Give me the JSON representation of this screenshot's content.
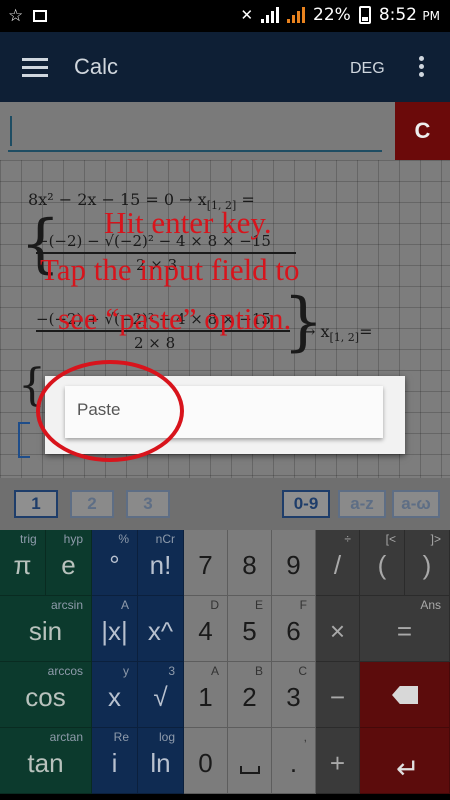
{
  "status_bar": {
    "battery": "22%",
    "time": "8:52",
    "ampm": "PM"
  },
  "app_bar": {
    "title": "Calc",
    "angle_mode": "DEG"
  },
  "input": {
    "value": "",
    "clear_label": "C"
  },
  "work": {
    "line1": "8x² − 2x − 15 = 0 → x",
    "line1_sub": "[1, 2]",
    "line1_tail": " =",
    "num1": "−(−2) − √(−2)² − 4 × 8 × −15",
    "den1": "2 × 3",
    "num2": "−(−2) + √(−2)² − 4 × 8 × −15",
    "den2": "2 × 8",
    "line2_tail": "→ x",
    "line2_sub": "[1, 2]",
    "line2_eq": "="
  },
  "overlay_instruction": [
    "Hit enter key.",
    "Tap the input field to",
    "see “paste” option."
  ],
  "popup": {
    "paste_label": "Paste"
  },
  "tabs": [
    "1",
    "2",
    "3",
    "0-9",
    "a-z",
    "a-ω"
  ],
  "keys": {
    "col1": [
      {
        "main": "π",
        "sub": "trig"
      },
      {
        "main": "sin",
        "sub": "arcsin"
      },
      {
        "main": "cos",
        "sub": "arccos"
      },
      {
        "main": "tan",
        "sub": "arctan"
      }
    ],
    "col2": [
      {
        "main": "e",
        "sub": "hyp"
      },
      {
        "main": "|x|",
        "sub": "A"
      },
      {
        "main": "x",
        "sub": "y"
      },
      {
        "main": "i",
        "sub": "Re"
      }
    ],
    "col3": [
      {
        "main": "°",
        "sub": "%"
      },
      {
        "main": "x^",
        "sub": ""
      },
      {
        "main": "√",
        "sub": "3"
      },
      {
        "main": "ln",
        "sub": "log"
      }
    ],
    "col3b": [
      {
        "main": "n!",
        "sub": "nCr"
      }
    ],
    "digits": [
      [
        "7",
        "8",
        "9"
      ],
      [
        "4",
        "5",
        "6"
      ],
      [
        "1",
        "2",
        "3"
      ],
      [
        "0",
        "",
        "."
      ]
    ],
    "digit_subs": [
      [
        "",
        "",
        ""
      ],
      [
        "D",
        "E",
        "F"
      ],
      [
        "A",
        "B",
        "C"
      ],
      [
        "",
        "",
        ","
      ]
    ],
    "ops": [
      [
        "/",
        "(",
        ")"
      ],
      [
        "×",
        "="
      ],
      [
        "−",
        "backspace"
      ],
      [
        "+",
        "enter"
      ]
    ],
    "op_subs": [
      [
        "÷",
        "[<",
        "]>"
      ],
      [
        "",
        "Ans"
      ],
      [
        "",
        ""
      ],
      [
        "",
        ""
      ]
    ]
  },
  "colors": {
    "accent_red": "#d8141c",
    "app_bar": "#0e1f35"
  }
}
